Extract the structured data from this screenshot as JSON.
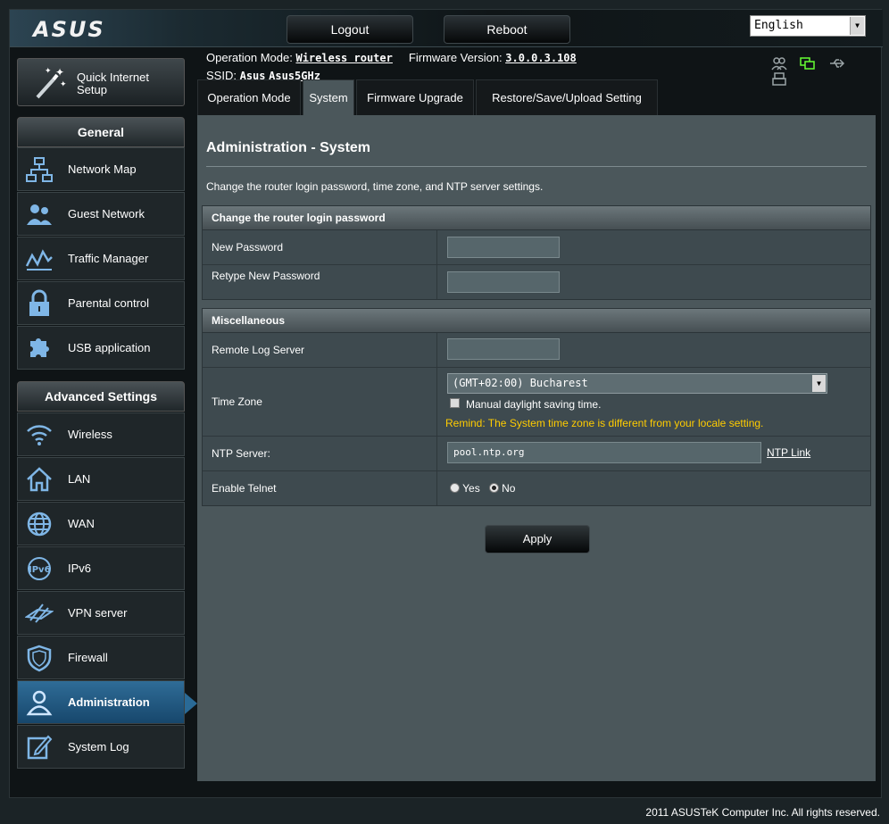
{
  "header": {
    "logo": "ASUS",
    "logout_label": "Logout",
    "reboot_label": "Reboot",
    "language": "English"
  },
  "info": {
    "op_mode_label": "Operation Mode:",
    "op_mode_value": "Wireless router",
    "fw_label": "Firmware Version:",
    "fw_value": "3.0.0.3.108",
    "ssid_label": "SSID:",
    "ssid_1": "Asus",
    "ssid_2": "Asus5GHz"
  },
  "status_icons": [
    "clients-icon",
    "internet-status-icon",
    "usb-icon",
    "printer-icon"
  ],
  "tabs": [
    {
      "label": "Operation Mode"
    },
    {
      "label": "System"
    },
    {
      "label": "Firmware Upgrade"
    },
    {
      "label": "Restore/Save/Upload Setting"
    }
  ],
  "sidebar": {
    "qis_label": "Quick Internet Setup",
    "general_head": "General",
    "general_items": [
      {
        "label": "Network Map",
        "icon": "network-map-icon"
      },
      {
        "label": "Guest Network",
        "icon": "guest-network-icon"
      },
      {
        "label": "Traffic Manager",
        "icon": "traffic-manager-icon"
      },
      {
        "label": "Parental control",
        "icon": "lock-icon"
      },
      {
        "label": "USB application",
        "icon": "puzzle-icon"
      }
    ],
    "advanced_head": "Advanced Settings",
    "advanced_items": [
      {
        "label": "Wireless",
        "icon": "wifi-icon"
      },
      {
        "label": "LAN",
        "icon": "home-icon"
      },
      {
        "label": "WAN",
        "icon": "globe-icon"
      },
      {
        "label": "IPv6",
        "icon": "ipv6-icon"
      },
      {
        "label": "VPN server",
        "icon": "vpn-icon"
      },
      {
        "label": "Firewall",
        "icon": "shield-icon"
      },
      {
        "label": "Administration",
        "icon": "admin-user-icon"
      },
      {
        "label": "System Log",
        "icon": "edit-log-icon"
      }
    ]
  },
  "content": {
    "title": "Administration - System",
    "description": "Change the router login password, time zone, and NTP server settings.",
    "password_section": {
      "head": "Change the router login password",
      "new_password_label": "New Password",
      "retype_password_label": "Retype New Password"
    },
    "misc_section": {
      "head": "Miscellaneous",
      "remote_log_label": "Remote Log Server",
      "remote_log_value": "",
      "time_zone_label": "Time Zone",
      "time_zone_value": "(GMT+02:00) Bucharest",
      "dst_label": "Manual daylight saving time.",
      "remind_text": "Remind: The System time zone is different from your locale setting.",
      "ntp_label": "NTP Server:",
      "ntp_value": "pool.ntp.org",
      "ntp_link": "NTP Link",
      "telnet_label": "Enable Telnet",
      "telnet_yes": "Yes",
      "telnet_no": "No",
      "telnet_selected": "No"
    },
    "apply_label": "Apply"
  },
  "footer": "2011 ASUSTeK Computer Inc. All rights reserved.",
  "colors": {
    "remind": "#ffcc00",
    "active_menu": "#2a6a96",
    "status_green": "#66ff33"
  }
}
